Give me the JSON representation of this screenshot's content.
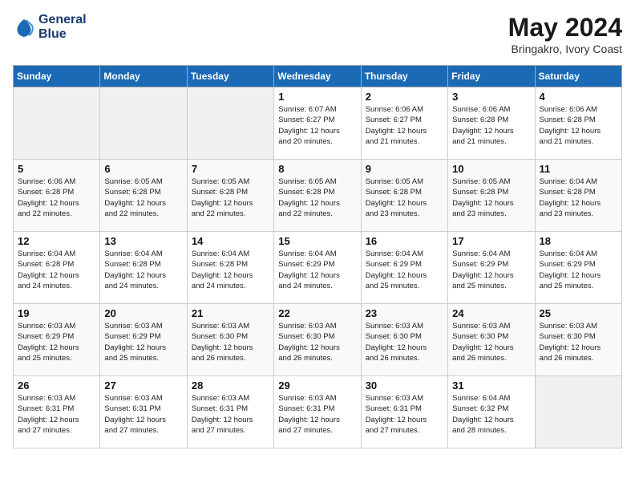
{
  "logo": {
    "line1": "General",
    "line2": "Blue"
  },
  "title": "May 2024",
  "location": "Bringakro, Ivory Coast",
  "weekdays": [
    "Sunday",
    "Monday",
    "Tuesday",
    "Wednesday",
    "Thursday",
    "Friday",
    "Saturday"
  ],
  "weeks": [
    [
      {
        "day": "",
        "info": ""
      },
      {
        "day": "",
        "info": ""
      },
      {
        "day": "",
        "info": ""
      },
      {
        "day": "1",
        "info": "Sunrise: 6:07 AM\nSunset: 6:27 PM\nDaylight: 12 hours\nand 20 minutes."
      },
      {
        "day": "2",
        "info": "Sunrise: 6:06 AM\nSunset: 6:27 PM\nDaylight: 12 hours\nand 21 minutes."
      },
      {
        "day": "3",
        "info": "Sunrise: 6:06 AM\nSunset: 6:28 PM\nDaylight: 12 hours\nand 21 minutes."
      },
      {
        "day": "4",
        "info": "Sunrise: 6:06 AM\nSunset: 6:28 PM\nDaylight: 12 hours\nand 21 minutes."
      }
    ],
    [
      {
        "day": "5",
        "info": "Sunrise: 6:06 AM\nSunset: 6:28 PM\nDaylight: 12 hours\nand 22 minutes."
      },
      {
        "day": "6",
        "info": "Sunrise: 6:05 AM\nSunset: 6:28 PM\nDaylight: 12 hours\nand 22 minutes."
      },
      {
        "day": "7",
        "info": "Sunrise: 6:05 AM\nSunset: 6:28 PM\nDaylight: 12 hours\nand 22 minutes."
      },
      {
        "day": "8",
        "info": "Sunrise: 6:05 AM\nSunset: 6:28 PM\nDaylight: 12 hours\nand 22 minutes."
      },
      {
        "day": "9",
        "info": "Sunrise: 6:05 AM\nSunset: 6:28 PM\nDaylight: 12 hours\nand 23 minutes."
      },
      {
        "day": "10",
        "info": "Sunrise: 6:05 AM\nSunset: 6:28 PM\nDaylight: 12 hours\nand 23 minutes."
      },
      {
        "day": "11",
        "info": "Sunrise: 6:04 AM\nSunset: 6:28 PM\nDaylight: 12 hours\nand 23 minutes."
      }
    ],
    [
      {
        "day": "12",
        "info": "Sunrise: 6:04 AM\nSunset: 6:28 PM\nDaylight: 12 hours\nand 24 minutes."
      },
      {
        "day": "13",
        "info": "Sunrise: 6:04 AM\nSunset: 6:28 PM\nDaylight: 12 hours\nand 24 minutes."
      },
      {
        "day": "14",
        "info": "Sunrise: 6:04 AM\nSunset: 6:28 PM\nDaylight: 12 hours\nand 24 minutes."
      },
      {
        "day": "15",
        "info": "Sunrise: 6:04 AM\nSunset: 6:29 PM\nDaylight: 12 hours\nand 24 minutes."
      },
      {
        "day": "16",
        "info": "Sunrise: 6:04 AM\nSunset: 6:29 PM\nDaylight: 12 hours\nand 25 minutes."
      },
      {
        "day": "17",
        "info": "Sunrise: 6:04 AM\nSunset: 6:29 PM\nDaylight: 12 hours\nand 25 minutes."
      },
      {
        "day": "18",
        "info": "Sunrise: 6:04 AM\nSunset: 6:29 PM\nDaylight: 12 hours\nand 25 minutes."
      }
    ],
    [
      {
        "day": "19",
        "info": "Sunrise: 6:03 AM\nSunset: 6:29 PM\nDaylight: 12 hours\nand 25 minutes."
      },
      {
        "day": "20",
        "info": "Sunrise: 6:03 AM\nSunset: 6:29 PM\nDaylight: 12 hours\nand 25 minutes."
      },
      {
        "day": "21",
        "info": "Sunrise: 6:03 AM\nSunset: 6:30 PM\nDaylight: 12 hours\nand 26 minutes."
      },
      {
        "day": "22",
        "info": "Sunrise: 6:03 AM\nSunset: 6:30 PM\nDaylight: 12 hours\nand 26 minutes."
      },
      {
        "day": "23",
        "info": "Sunrise: 6:03 AM\nSunset: 6:30 PM\nDaylight: 12 hours\nand 26 minutes."
      },
      {
        "day": "24",
        "info": "Sunrise: 6:03 AM\nSunset: 6:30 PM\nDaylight: 12 hours\nand 26 minutes."
      },
      {
        "day": "25",
        "info": "Sunrise: 6:03 AM\nSunset: 6:30 PM\nDaylight: 12 hours\nand 26 minutes."
      }
    ],
    [
      {
        "day": "26",
        "info": "Sunrise: 6:03 AM\nSunset: 6:31 PM\nDaylight: 12 hours\nand 27 minutes."
      },
      {
        "day": "27",
        "info": "Sunrise: 6:03 AM\nSunset: 6:31 PM\nDaylight: 12 hours\nand 27 minutes."
      },
      {
        "day": "28",
        "info": "Sunrise: 6:03 AM\nSunset: 6:31 PM\nDaylight: 12 hours\nand 27 minutes."
      },
      {
        "day": "29",
        "info": "Sunrise: 6:03 AM\nSunset: 6:31 PM\nDaylight: 12 hours\nand 27 minutes."
      },
      {
        "day": "30",
        "info": "Sunrise: 6:03 AM\nSunset: 6:31 PM\nDaylight: 12 hours\nand 27 minutes."
      },
      {
        "day": "31",
        "info": "Sunrise: 6:04 AM\nSunset: 6:32 PM\nDaylight: 12 hours\nand 28 minutes."
      },
      {
        "day": "",
        "info": ""
      }
    ]
  ]
}
